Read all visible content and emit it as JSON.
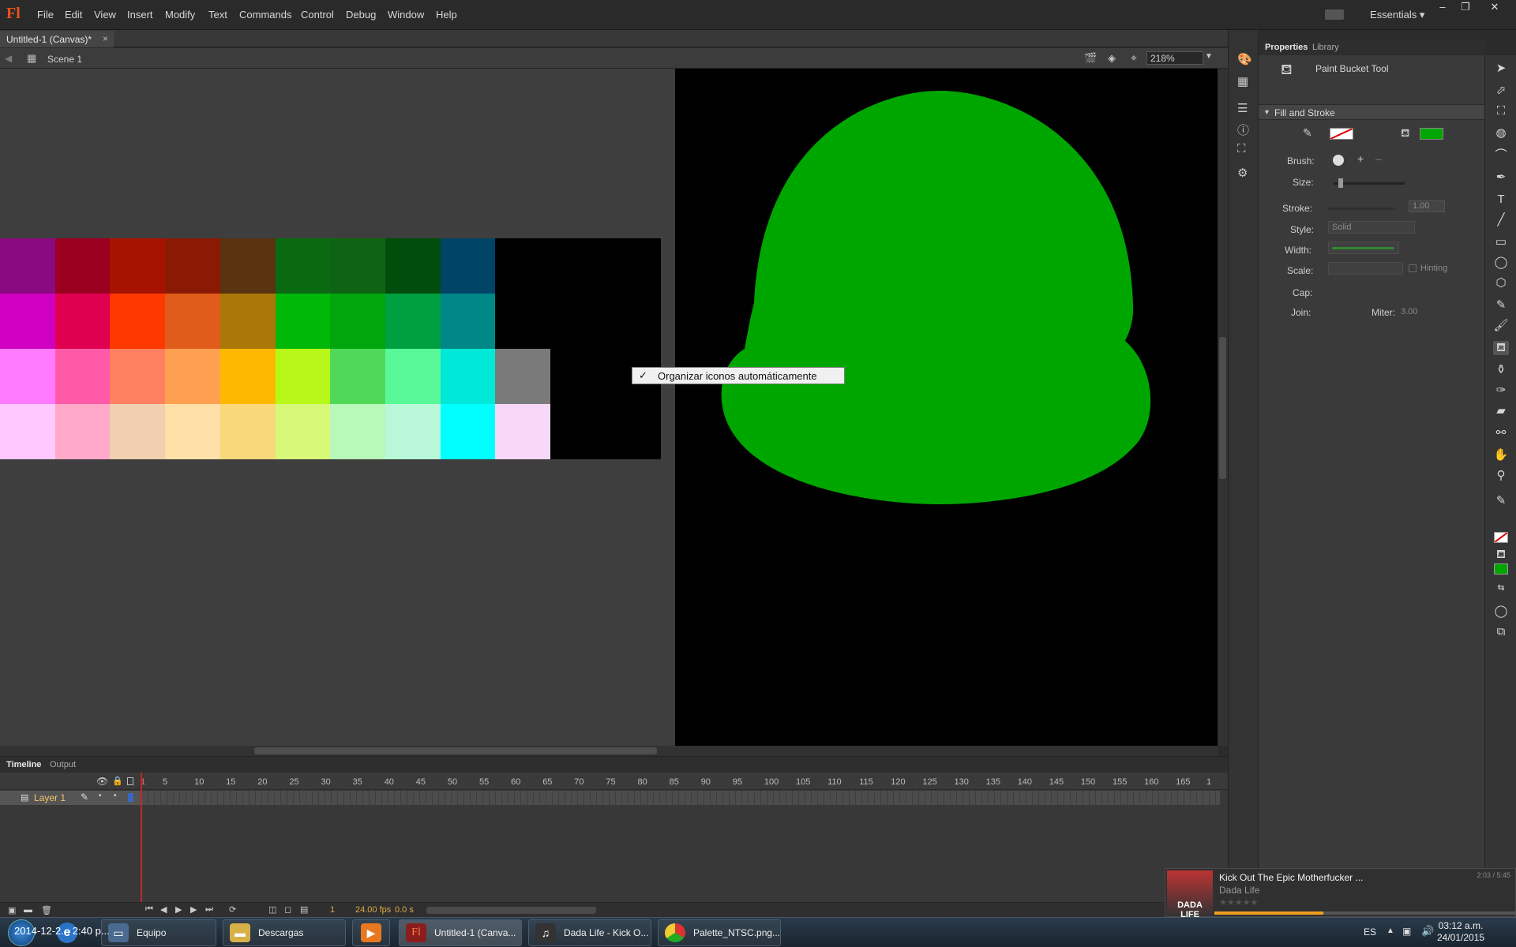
{
  "menubar": {
    "logo": "Fl",
    "items": [
      "File",
      "Edit",
      "View",
      "Insert",
      "Modify",
      "Text",
      "Commands",
      "Control",
      "Debug",
      "Window",
      "Help"
    ],
    "workspace": "Essentials"
  },
  "document": {
    "tab_title": "Untitled-1 (Canvas)*",
    "close": "×"
  },
  "editbar": {
    "scene": "Scene 1",
    "zoom": "218%"
  },
  "palette": {
    "rows": [
      [
        "#8a0a80",
        "#9c0020",
        "#a51300",
        "#8b1a05",
        "#5a3310",
        "#0a6a12",
        "#0e6412",
        "#004d0c",
        "#004466",
        "#000000",
        "#000000",
        "#000000"
      ],
      [
        "#d000c0",
        "#e00050",
        "#ff3800",
        "#e05c1a",
        "#aa7808",
        "#00b808",
        "#00a60c",
        "#00a040",
        "#008888",
        "#000000",
        "#000000",
        "#000000"
      ],
      [
        "#ff7aff",
        "#ff5aa8",
        "#ff8060",
        "#ffa050",
        "#ffb800",
        "#b8f818",
        "#50d858",
        "#58f898",
        "#00e8d8",
        "#7a7a7a",
        "#000000",
        "#000000"
      ],
      [
        "#ffc8ff",
        "#ffa8c8",
        "#f0d0b0",
        "#ffe0a8",
        "#f8d878",
        "#d8f878",
        "#b8f8b8",
        "#b8f8d8",
        "#00ffff",
        "#f8d8f8",
        "#000000",
        "#000000"
      ]
    ]
  },
  "context_menu": {
    "check": "✓",
    "item": "Organizar iconos automáticamente"
  },
  "stage": {
    "shape_color": "#00a600"
  },
  "timeline": {
    "tabs": [
      "Timeline",
      "Output"
    ],
    "ruler": [
      "1",
      "5",
      "10",
      "15",
      "20",
      "25",
      "30",
      "35",
      "40",
      "45",
      "50",
      "55",
      "60",
      "65",
      "70",
      "75",
      "80",
      "85",
      "90",
      "95",
      "100",
      "105",
      "110",
      "115",
      "120",
      "125",
      "130",
      "135",
      "140",
      "145",
      "150",
      "155",
      "160",
      "165",
      "1"
    ],
    "layer": "Layer 1",
    "frame": "1",
    "fps": "24.00 fps",
    "elapsed": "0.0 s"
  },
  "properties": {
    "tabs": [
      "Properties",
      "Library"
    ],
    "tool": "Paint Bucket Tool",
    "section": "Fill and Stroke",
    "fill_color": "#00a600",
    "labels": {
      "brush": "Brush:",
      "size": "Size:",
      "stroke": "Stroke:",
      "stroke_value": "1.00",
      "style": "Style:",
      "style_value": "Solid",
      "width": "Width:",
      "scale": "Scale:",
      "hinting": "Hinting",
      "cap": "Cap:",
      "join": "Join:",
      "miter": "Miter:",
      "miter_value": "3.00"
    }
  },
  "taskbar": {
    "items": [
      {
        "label": "Equipo",
        "icon": "computer-icon"
      },
      {
        "label": "Descargas",
        "icon": "folder-icon"
      },
      {
        "label": "",
        "icon": "media-player-icon"
      },
      {
        "label": "Untitled-1 (Canva...",
        "icon": "flash-icon"
      },
      {
        "label": "Dada Life - Kick O...",
        "icon": "music-icon"
      },
      {
        "label": "Palette_NTSC.png...",
        "icon": "chrome-icon"
      }
    ],
    "lang": "ES",
    "time": "03:12 a.m.",
    "date": "24/01/2015",
    "desktop_text": "2014-12-2... 2:40 p..."
  },
  "media": {
    "title": "Kick Out The Epic Motherfucker ...",
    "artist": "Dada Life",
    "time": "2:03 / 5:45",
    "art_text": "DADA LIFE",
    "progress": 0.36
  }
}
